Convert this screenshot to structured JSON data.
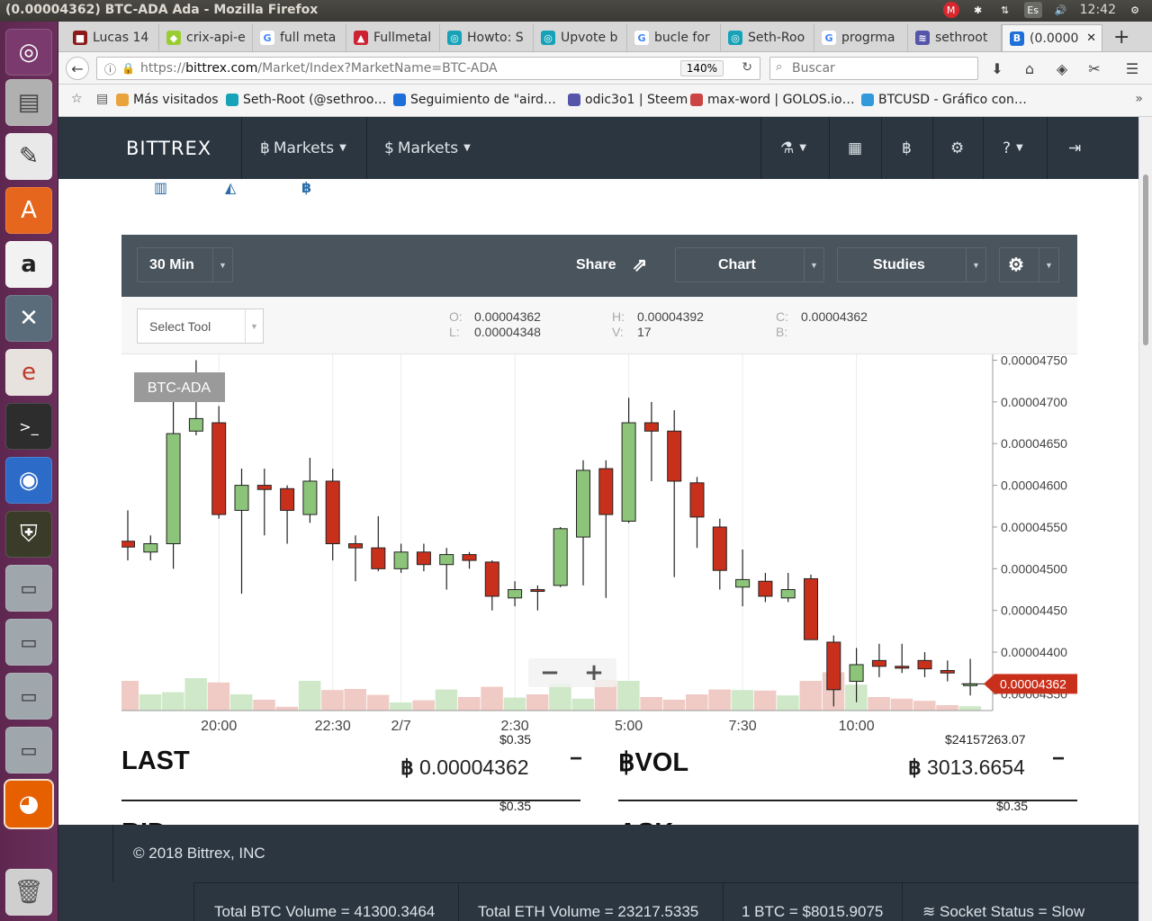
{
  "desktop": {
    "window_title": "(0.00004362) BTC-ADA Ada - Mozilla Firefox",
    "clock": "12:42",
    "keyboard_layout": "Es"
  },
  "tabs": [
    {
      "label": "Lucas 14",
      "favicon_color": "#8b1a1a",
      "favicon_glyph": "■"
    },
    {
      "label": "crix-api-e",
      "favicon_color": "#9acd32",
      "favicon_glyph": "◆"
    },
    {
      "label": "full meta",
      "favicon_color": "#ffffff",
      "favicon_glyph": "G"
    },
    {
      "label": "Fullmetal",
      "favicon_color": "#cc2233",
      "favicon_glyph": "▲"
    },
    {
      "label": "Howto: S",
      "favicon_color": "#17a2b8",
      "favicon_glyph": "◎"
    },
    {
      "label": "Upvote b",
      "favicon_color": "#17a2b8",
      "favicon_glyph": "◎"
    },
    {
      "label": "bucle for",
      "favicon_color": "#ffffff",
      "favicon_glyph": "G"
    },
    {
      "label": "Seth-Roo",
      "favicon_color": "#17a2b8",
      "favicon_glyph": "◎"
    },
    {
      "label": "progrma",
      "favicon_color": "#ffffff",
      "favicon_glyph": "G"
    },
    {
      "label": "sethroot",
      "favicon_color": "#5555aa",
      "favicon_glyph": "≋"
    },
    {
      "label": "(0.0000",
      "favicon_color": "#1e6fd9",
      "favicon_glyph": "B",
      "active": true
    }
  ],
  "navbar": {
    "url_prefix": "https://",
    "url_domain": "bittrex.com",
    "url_path": "/Market/Index?MarketName=BTC-ADA",
    "zoom": "140%",
    "search_placeholder": "Buscar"
  },
  "bookmarks": [
    {
      "label": "Más visitados",
      "icon": "folder-icon",
      "color": "#e8a33c"
    },
    {
      "label": "Seth-Root (@sethroo…",
      "icon": "steemit-icon",
      "color": "#17a2b8"
    },
    {
      "label": "Seguimiento de \"aird…",
      "icon": "b-icon",
      "color": "#1e6fd9"
    },
    {
      "label": "odic3o1 | Steem",
      "icon": "steem-icon",
      "color": "#5555aa"
    },
    {
      "label": "max-word | GOLOS.io…",
      "icon": "golos-icon",
      "color": "#cc4444"
    },
    {
      "label": "BTCUSD - Gráfico con…",
      "icon": "tradingview-icon",
      "color": "#3399dd"
    }
  ],
  "bittrex_nav": {
    "logo": "BITTREX",
    "menu_btc_markets": "Markets",
    "menu_usd_markets": "Markets"
  },
  "chart_toolbar": {
    "interval": "30 Min",
    "share": "Share",
    "chart": "Chart",
    "studies": "Studies",
    "select_tool": "Select Tool"
  },
  "ohlc": {
    "o_label": "O:",
    "o_value": "0.00004362",
    "l_label": "L:",
    "l_value": "0.00004348",
    "h_label": "H:",
    "h_value": "0.00004392",
    "v_label": "V:",
    "v_value": "17",
    "c_label": "C:",
    "c_value": "0.00004362",
    "b_label": "B:",
    "b_value": ""
  },
  "chart_data": {
    "type": "candlestick",
    "symbol_label": "BTC-ADA",
    "last_price_label": "0.00004362",
    "x_tick_labels": [
      "20:00",
      "22:30",
      "2/7",
      "2:30",
      "5:00",
      "7:30",
      "10:00"
    ],
    "x_tick_index": [
      4,
      9,
      12,
      17,
      22,
      27,
      32
    ],
    "y_ticks": [
      4.35e-05,
      4.4e-05,
      4.45e-05,
      4.5e-05,
      4.55e-05,
      4.6e-05,
      4.65e-05,
      4.7e-05,
      4.75e-05
    ],
    "y_tick_labels": [
      "0.00004350",
      "0.00004400",
      "0.00004450",
      "0.00004500",
      "0.00004550",
      "0.00004600",
      "0.00004650",
      "0.00004700",
      "0.00004750"
    ],
    "ylim": [
      4.33e-05,
      4.757e-05
    ],
    "colors": {
      "up": "#8cc47a",
      "down": "#c9301c",
      "up_vol": "#cfe8c8",
      "down_vol": "#f0cac4",
      "wick": "#222222"
    },
    "candles": [
      {
        "o": 4.533e-05,
        "h": 4.57e-05,
        "l": 4.51e-05,
        "c": 4.526e-05
      },
      {
        "o": 4.52e-05,
        "h": 4.54e-05,
        "l": 4.51e-05,
        "c": 4.53e-05
      },
      {
        "o": 4.53e-05,
        "h": 4.73e-05,
        "l": 4.5e-05,
        "c": 4.662e-05
      },
      {
        "o": 4.665e-05,
        "h": 4.75e-05,
        "l": 4.66e-05,
        "c": 4.68e-05
      },
      {
        "o": 4.675e-05,
        "h": 4.695e-05,
        "l": 4.56e-05,
        "c": 4.565e-05
      },
      {
        "o": 4.57e-05,
        "h": 4.62e-05,
        "l": 4.47e-05,
        "c": 4.6e-05
      },
      {
        "o": 4.6e-05,
        "h": 4.62e-05,
        "l": 4.54e-05,
        "c": 4.595e-05
      },
      {
        "o": 4.596e-05,
        "h": 4.6e-05,
        "l": 4.53e-05,
        "c": 4.57e-05
      },
      {
        "o": 4.565e-05,
        "h": 4.633e-05,
        "l": 4.555e-05,
        "c": 4.605e-05
      },
      {
        "o": 4.605e-05,
        "h": 4.62e-05,
        "l": 4.51e-05,
        "c": 4.53e-05
      },
      {
        "o": 4.53e-05,
        "h": 4.54e-05,
        "l": 4.485e-05,
        "c": 4.525e-05
      },
      {
        "o": 4.525e-05,
        "h": 4.563e-05,
        "l": 4.497e-05,
        "c": 4.5e-05
      },
      {
        "o": 4.5e-05,
        "h": 4.53e-05,
        "l": 4.495e-05,
        "c": 4.52e-05
      },
      {
        "o": 4.52e-05,
        "h": 4.53e-05,
        "l": 4.497e-05,
        "c": 4.505e-05
      },
      {
        "o": 4.505e-05,
        "h": 4.525e-05,
        "l": 4.475e-05,
        "c": 4.517e-05
      },
      {
        "o": 4.517e-05,
        "h": 4.52e-05,
        "l": 4.5e-05,
        "c": 4.51e-05
      },
      {
        "o": 4.508e-05,
        "h": 4.51e-05,
        "l": 4.45e-05,
        "c": 4.467e-05
      },
      {
        "o": 4.465e-05,
        "h": 4.485e-05,
        "l": 4.455e-05,
        "c": 4.475e-05
      },
      {
        "o": 4.475e-05,
        "h": 4.48e-05,
        "l": 4.45e-05,
        "c": 4.473e-05
      },
      {
        "o": 4.48e-05,
        "h": 4.55e-05,
        "l": 4.478e-05,
        "c": 4.548e-05
      },
      {
        "o": 4.538e-05,
        "h": 4.63e-05,
        "l": 4.48e-05,
        "c": 4.618e-05
      },
      {
        "o": 4.62e-05,
        "h": 4.63e-05,
        "l": 4.465e-05,
        "c": 4.565e-05
      },
      {
        "o": 4.557e-05,
        "h": 4.705e-05,
        "l": 4.555e-05,
        "c": 4.675e-05
      },
      {
        "o": 4.675e-05,
        "h": 4.7e-05,
        "l": 4.605e-05,
        "c": 4.665e-05
      },
      {
        "o": 4.665e-05,
        "h": 4.69e-05,
        "l": 4.49e-05,
        "c": 4.605e-05
      },
      {
        "o": 4.603e-05,
        "h": 4.61e-05,
        "l": 4.525e-05,
        "c": 4.562e-05
      },
      {
        "o": 4.55e-05,
        "h": 4.56e-05,
        "l": 4.475e-05,
        "c": 4.498e-05
      },
      {
        "o": 4.478e-05,
        "h": 4.523e-05,
        "l": 4.455e-05,
        "c": 4.487e-05
      },
      {
        "o": 4.485e-05,
        "h": 4.495e-05,
        "l": 4.46e-05,
        "c": 4.467e-05
      },
      {
        "o": 4.465e-05,
        "h": 4.495e-05,
        "l": 4.46e-05,
        "c": 4.475e-05
      },
      {
        "o": 4.488e-05,
        "h": 4.493e-05,
        "l": 4.44e-05,
        "c": 4.415e-05
      },
      {
        "o": 4.412e-05,
        "h": 4.42e-05,
        "l": 4.335e-05,
        "c": 4.355e-05
      },
      {
        "o": 4.365e-05,
        "h": 4.405e-05,
        "l": 4.34e-05,
        "c": 4.385e-05
      },
      {
        "o": 4.39e-05,
        "h": 4.41e-05,
        "l": 4.37e-05,
        "c": 4.383e-05
      },
      {
        "o": 4.383e-05,
        "h": 4.41e-05,
        "l": 4.375e-05,
        "c": 4.382e-05
      },
      {
        "o": 4.39e-05,
        "h": 4.4e-05,
        "l": 4.37e-05,
        "c": 4.38e-05
      },
      {
        "o": 4.378e-05,
        "h": 4.39e-05,
        "l": 4.365e-05,
        "c": 4.375e-05
      },
      {
        "o": 4.362e-05,
        "h": 4.392e-05,
        "l": 4.348e-05,
        "c": 4.362e-05
      }
    ],
    "volumes": [
      0.55,
      0.3,
      0.34,
      0.6,
      0.52,
      0.3,
      0.2,
      0.07,
      0.55,
      0.38,
      0.4,
      0.29,
      0.15,
      0.19,
      0.39,
      0.25,
      0.44,
      0.24,
      0.3,
      0.5,
      0.22,
      0.57,
      0.55,
      0.25,
      0.2,
      0.3,
      0.39,
      0.38,
      0.37,
      0.28,
      0.55,
      0.71,
      0.48,
      0.25,
      0.22,
      0.18,
      0.1,
      0.08
    ]
  },
  "stats": {
    "last_label": "LAST",
    "last_usd": "$0.35",
    "last_btc": "0.00004362",
    "bvol_label": "VOL",
    "bvol_usd": "$24157263.07",
    "bvol_btc": "3013.6654",
    "bid_label": "BID",
    "bid_usd": "$0.35",
    "ask_label": "ASK",
    "ask_usd": "$0.35",
    "minus": "−",
    "btc_symbol": "฿"
  },
  "footer": {
    "copyright": "© 2018 Bittrex, INC",
    "total_btc": "Total BTC Volume = 41300.3464",
    "total_eth": "Total ETH Volume = 23217.5335",
    "btc_price": "1 BTC = $8015.9075",
    "socket": "Socket Status = Slow"
  }
}
